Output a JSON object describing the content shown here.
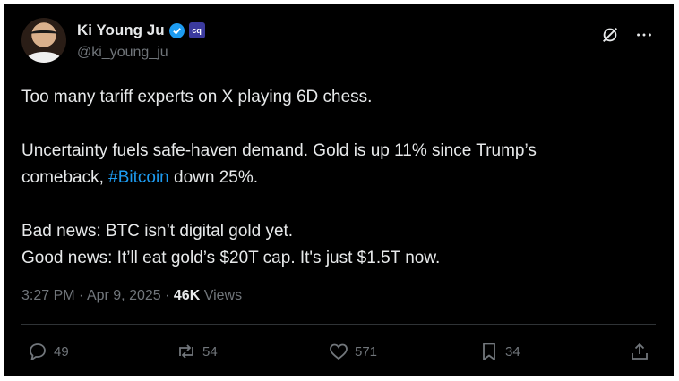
{
  "author": {
    "name": "Ki Young Ju",
    "handle": "@ki_young_ju",
    "affiliation_badge_text": "cq"
  },
  "tweet": {
    "lines": [
      "Too many tariff experts on X playing 6D chess.",
      "Uncertainty fuels safe-haven demand. Gold is up 11% since Trump’s",
      "comeback, ",
      "#Bitcoin",
      " down 25%.",
      "Bad news: BTC isn’t digital gold yet.",
      "Good news: It’ll eat gold’s $20T cap. It's just $1.5T now."
    ]
  },
  "meta": {
    "time": "3:27 PM",
    "sep1": " · ",
    "date": "Apr 9, 2025",
    "sep2": " · ",
    "views_count": "46K",
    "views_label": " Views"
  },
  "actions": {
    "replies": "49",
    "reposts": "54",
    "likes": "571",
    "bookmarks": "34"
  },
  "icons": {
    "verified": "verified-check-icon",
    "grok": "grok-icon",
    "more": "more-icon",
    "reply": "reply-icon",
    "repost": "repost-icon",
    "like": "heart-icon",
    "bookmark": "bookmark-icon",
    "share": "share-icon"
  },
  "colors": {
    "background": "#000000",
    "text": "#e7e9ea",
    "secondary": "#71767b",
    "link": "#1d9bf0",
    "verified": "#1d9bf0"
  }
}
